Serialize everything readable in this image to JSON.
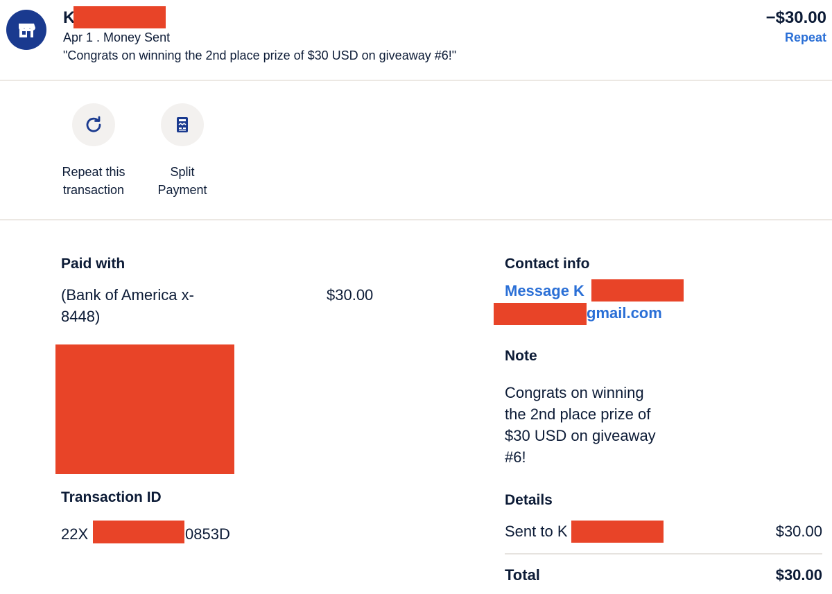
{
  "header": {
    "name_initial": "K",
    "date_type": "Apr 1 . Money Sent",
    "memo": "\"Congrats on winning the 2nd place prize of $30 USD on giveaway #6!\"",
    "amount": "−$30.00",
    "repeat_label": "Repeat",
    "avatar_icon": "store-icon"
  },
  "actions": [
    {
      "label_line1": "Repeat this",
      "label_line2": "transaction",
      "icon": "refresh-icon"
    },
    {
      "label_line1": "Split",
      "label_line2": "Payment",
      "icon": "receipt-icon"
    }
  ],
  "paid_with": {
    "heading": "Paid with",
    "source_line1": "(Bank of America x-",
    "source_line2": "8448)",
    "amount": "$30.00"
  },
  "transaction": {
    "heading": "Transaction ID",
    "id_prefix": "22X",
    "id_suffix": "0853D"
  },
  "contact": {
    "heading": "Contact info",
    "message_prefix": "Message K",
    "email_suffix": "gmail.com"
  },
  "note": {
    "heading": "Note",
    "lines": [
      "Congrats on winning",
      "the 2nd place prize of",
      "$30 USD on giveaway",
      "#6!"
    ]
  },
  "details": {
    "heading": "Details",
    "sent_to_label": "Sent to K",
    "sent_to_amount": "$30.00",
    "total_label": "Total",
    "total_amount": "$30.00"
  },
  "colors": {
    "accent": "#2a6fd6",
    "avatar_bg": "#1a3a8f",
    "text": "#0c1b36",
    "redaction": "#e84428"
  }
}
